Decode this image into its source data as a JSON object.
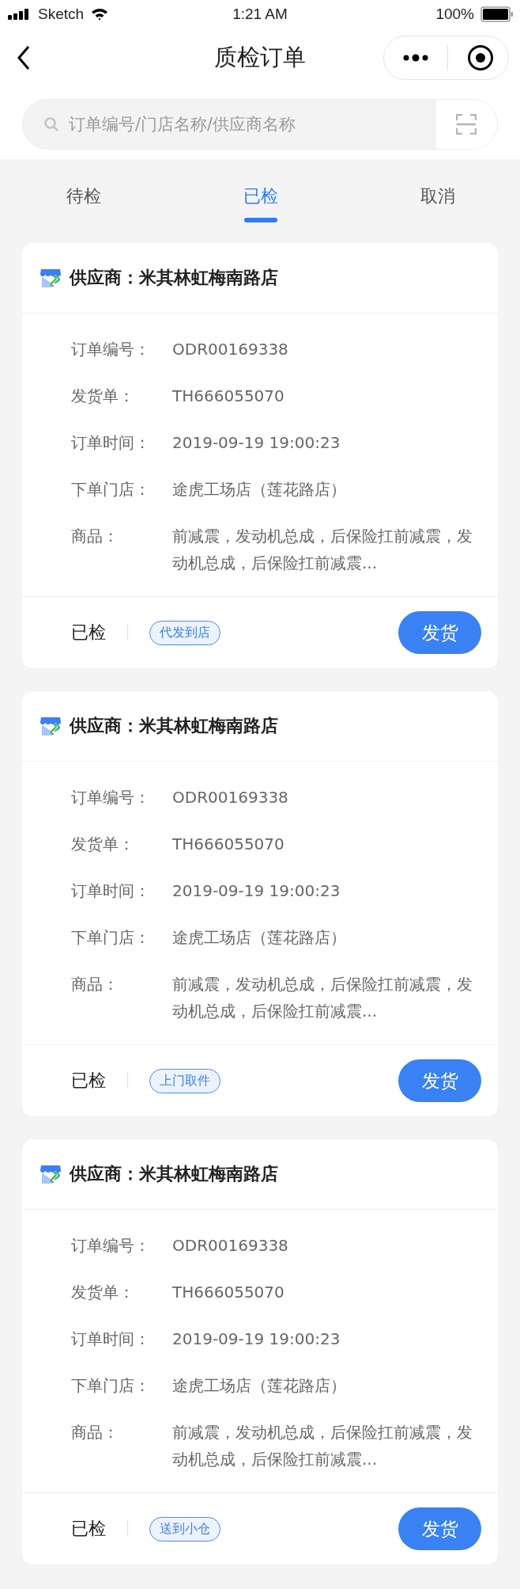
{
  "status_bar": {
    "carrier": "Sketch",
    "time": "1:21 AM",
    "battery": "100%"
  },
  "nav": {
    "title": "质检订单"
  },
  "search": {
    "placeholder": "订单编号/门店名称/供应商名称"
  },
  "tabs": [
    {
      "label": "待检",
      "selected": false
    },
    {
      "label": "已检",
      "selected": true
    },
    {
      "label": "取消",
      "selected": false
    }
  ],
  "orders": [
    {
      "supplier": "供应商：米其林虹梅南路店",
      "fields": [
        {
          "label": "订单编号：",
          "value": "ODR00169338"
        },
        {
          "label": "发货单：",
          "value": "TH666055070"
        },
        {
          "label": "订单时间：",
          "value": "2019-09-19 19:00:23"
        },
        {
          "label": "下单门店：",
          "value": "途虎工场店（莲花路店）"
        },
        {
          "label": "商品：",
          "value": "前减震，发动机总成，后保险扛前减震，发动机总成，后保险扛前减震..."
        }
      ],
      "status": "已检",
      "tag": "代发到店",
      "action": "发货"
    },
    {
      "supplier": "供应商：米其林虹梅南路店",
      "fields": [
        {
          "label": "订单编号：",
          "value": "ODR00169338"
        },
        {
          "label": "发货单：",
          "value": "TH666055070"
        },
        {
          "label": "订单时间：",
          "value": "2019-09-19 19:00:23"
        },
        {
          "label": "下单门店：",
          "value": "途虎工场店（莲花路店）"
        },
        {
          "label": "商品：",
          "value": "前减震，发动机总成，后保险扛前减震，发动机总成，后保险扛前减震..."
        }
      ],
      "status": "已检",
      "tag": "上门取件",
      "action": "发货"
    },
    {
      "supplier": "供应商：米其林虹梅南路店",
      "fields": [
        {
          "label": "订单编号：",
          "value": "ODR00169338"
        },
        {
          "label": "发货单：",
          "value": "TH666055070"
        },
        {
          "label": "订单时间：",
          "value": "2019-09-19 19:00:23"
        },
        {
          "label": "下单门店：",
          "value": "途虎工场店（莲花路店）"
        },
        {
          "label": "商品：",
          "value": "前减震，发动机总成，后保险扛前减震，发动机总成，后保险扛前减震..."
        }
      ],
      "status": "已检",
      "tag": "送到小仓",
      "action": "发货"
    }
  ]
}
